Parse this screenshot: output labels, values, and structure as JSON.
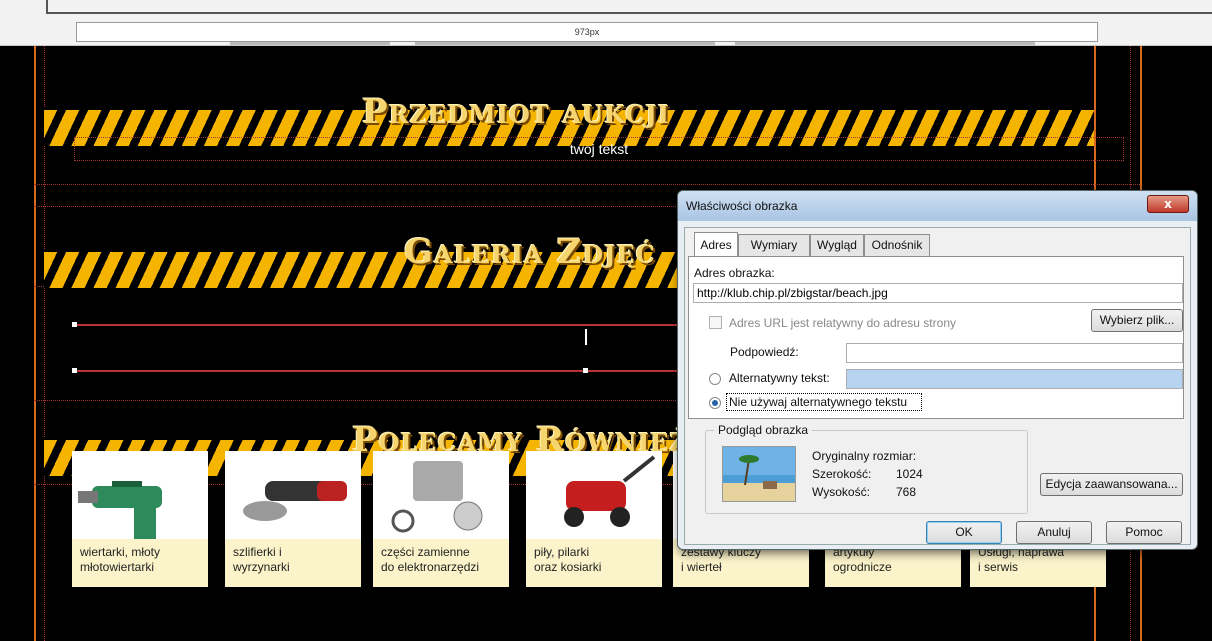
{
  "ruler": {
    "label": "973px"
  },
  "page": {
    "banners": [
      {
        "title": "Przedmiot aukcji"
      },
      {
        "title": "Galeria Zdjęć"
      },
      {
        "title": "Polecamy Również"
      }
    ],
    "text_placeholder": "twoj tekst"
  },
  "products": [
    {
      "line1": "wiertarki, młoty",
      "line2": "młotowiertarki",
      "icon": "drill-icon"
    },
    {
      "line1": "szlifierki i",
      "line2": "wyrzynarki",
      "icon": "angle-grinder-icon"
    },
    {
      "line1": "części zamienne",
      "line2": "do elektronarzędzi",
      "icon": "spare-parts-icon"
    },
    {
      "line1": "piły, pilarki",
      "line2": "oraz kosiarki",
      "icon": "lawn-mower-icon"
    },
    {
      "line1": "zestawy kluczy",
      "line2": "i wierteł",
      "icon": "wrench-set-icon"
    },
    {
      "line1": "artykuły",
      "line2": "ogrodnicze",
      "icon": "garden-tools-icon"
    },
    {
      "line1": "Usługi, naprawa",
      "line2": "i serwis",
      "icon": "service-icon"
    }
  ],
  "dialog": {
    "title": "Właściwości obrazka",
    "close_label": "x",
    "tabs": [
      "Adres",
      "Wymiary",
      "Wygląd",
      "Odnośnik"
    ],
    "active_tab": "Adres",
    "address_label": "Adres obrazka:",
    "address_value": "http://klub.chip.pl/zbigstar/beach.jpg",
    "relative_label": "Adres URL jest relatywny do adresu strony",
    "choose_file_button": "Wybierz plik...",
    "tooltip_label": "Podpowiedź:",
    "tooltip_value": "",
    "alt_label": "Alternatywny tekst:",
    "alt_value": "",
    "no_alt_label": "Nie używaj alternatywnego tekstu",
    "no_alt_selected": true,
    "preview_title": "Podgląd obrazka",
    "original_size_label": "Oryginalny rozmiar:",
    "width_label": "Szerokość:",
    "width_value": "1024",
    "height_label": "Wysokość:",
    "height_value": "768",
    "advanced_button": "Edycja zaawansowana...",
    "ok_button": "OK",
    "cancel_button": "Anuluj",
    "help_button": "Pomoc"
  },
  "colors": {
    "guide": "#d86a1e",
    "banner_yellow": "#f4b400",
    "tile_label_bg": "#fbf3c9"
  }
}
